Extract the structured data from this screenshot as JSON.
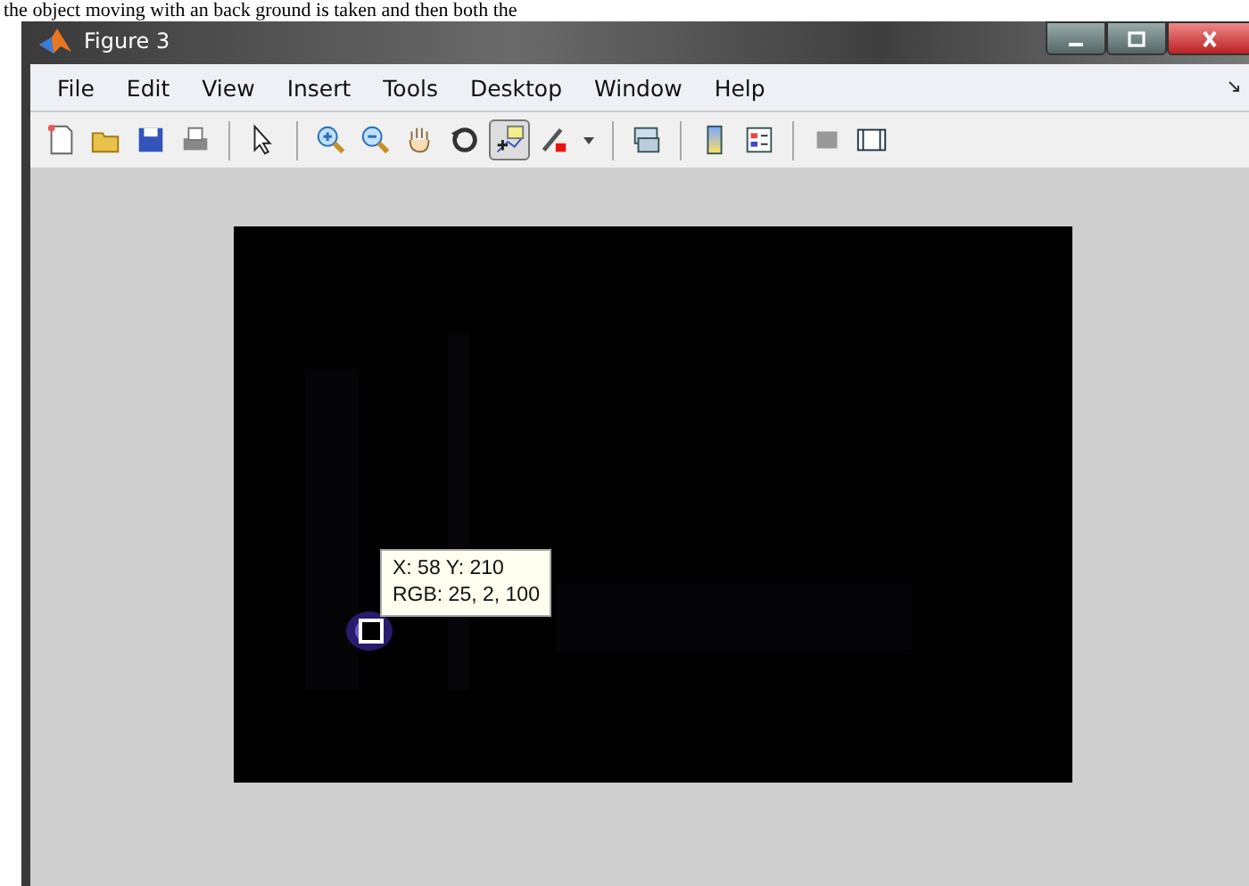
{
  "document_text": "the object moving with  an back ground is taken and then both the",
  "window": {
    "title": "Figure 3"
  },
  "menu": [
    "File",
    "Edit",
    "View",
    "Insert",
    "Tools",
    "Desktop",
    "Window",
    "Help"
  ],
  "toolbar": [
    {
      "kind": "new",
      "selected": false
    },
    {
      "kind": "open",
      "selected": false
    },
    {
      "kind": "save",
      "selected": false
    },
    {
      "kind": "print",
      "selected": false
    },
    {
      "kind": "sep"
    },
    {
      "kind": "pointer",
      "selected": false
    },
    {
      "kind": "sep"
    },
    {
      "kind": "zoom-in",
      "selected": false
    },
    {
      "kind": "zoom-out",
      "selected": false
    },
    {
      "kind": "pan",
      "selected": false
    },
    {
      "kind": "rotate",
      "selected": false
    },
    {
      "kind": "data-cursor",
      "selected": true
    },
    {
      "kind": "brush",
      "selected": false
    },
    {
      "kind": "caret"
    },
    {
      "kind": "sep"
    },
    {
      "kind": "link",
      "selected": false
    },
    {
      "kind": "sep"
    },
    {
      "kind": "colorbar",
      "selected": false
    },
    {
      "kind": "legend",
      "selected": false
    },
    {
      "kind": "sep"
    },
    {
      "kind": "hide-tools",
      "selected": false
    },
    {
      "kind": "show-tools",
      "selected": false
    }
  ],
  "datatip": {
    "lines": [
      "X: 58 Y: 210",
      "RGB: 25, 2, 100"
    ]
  }
}
